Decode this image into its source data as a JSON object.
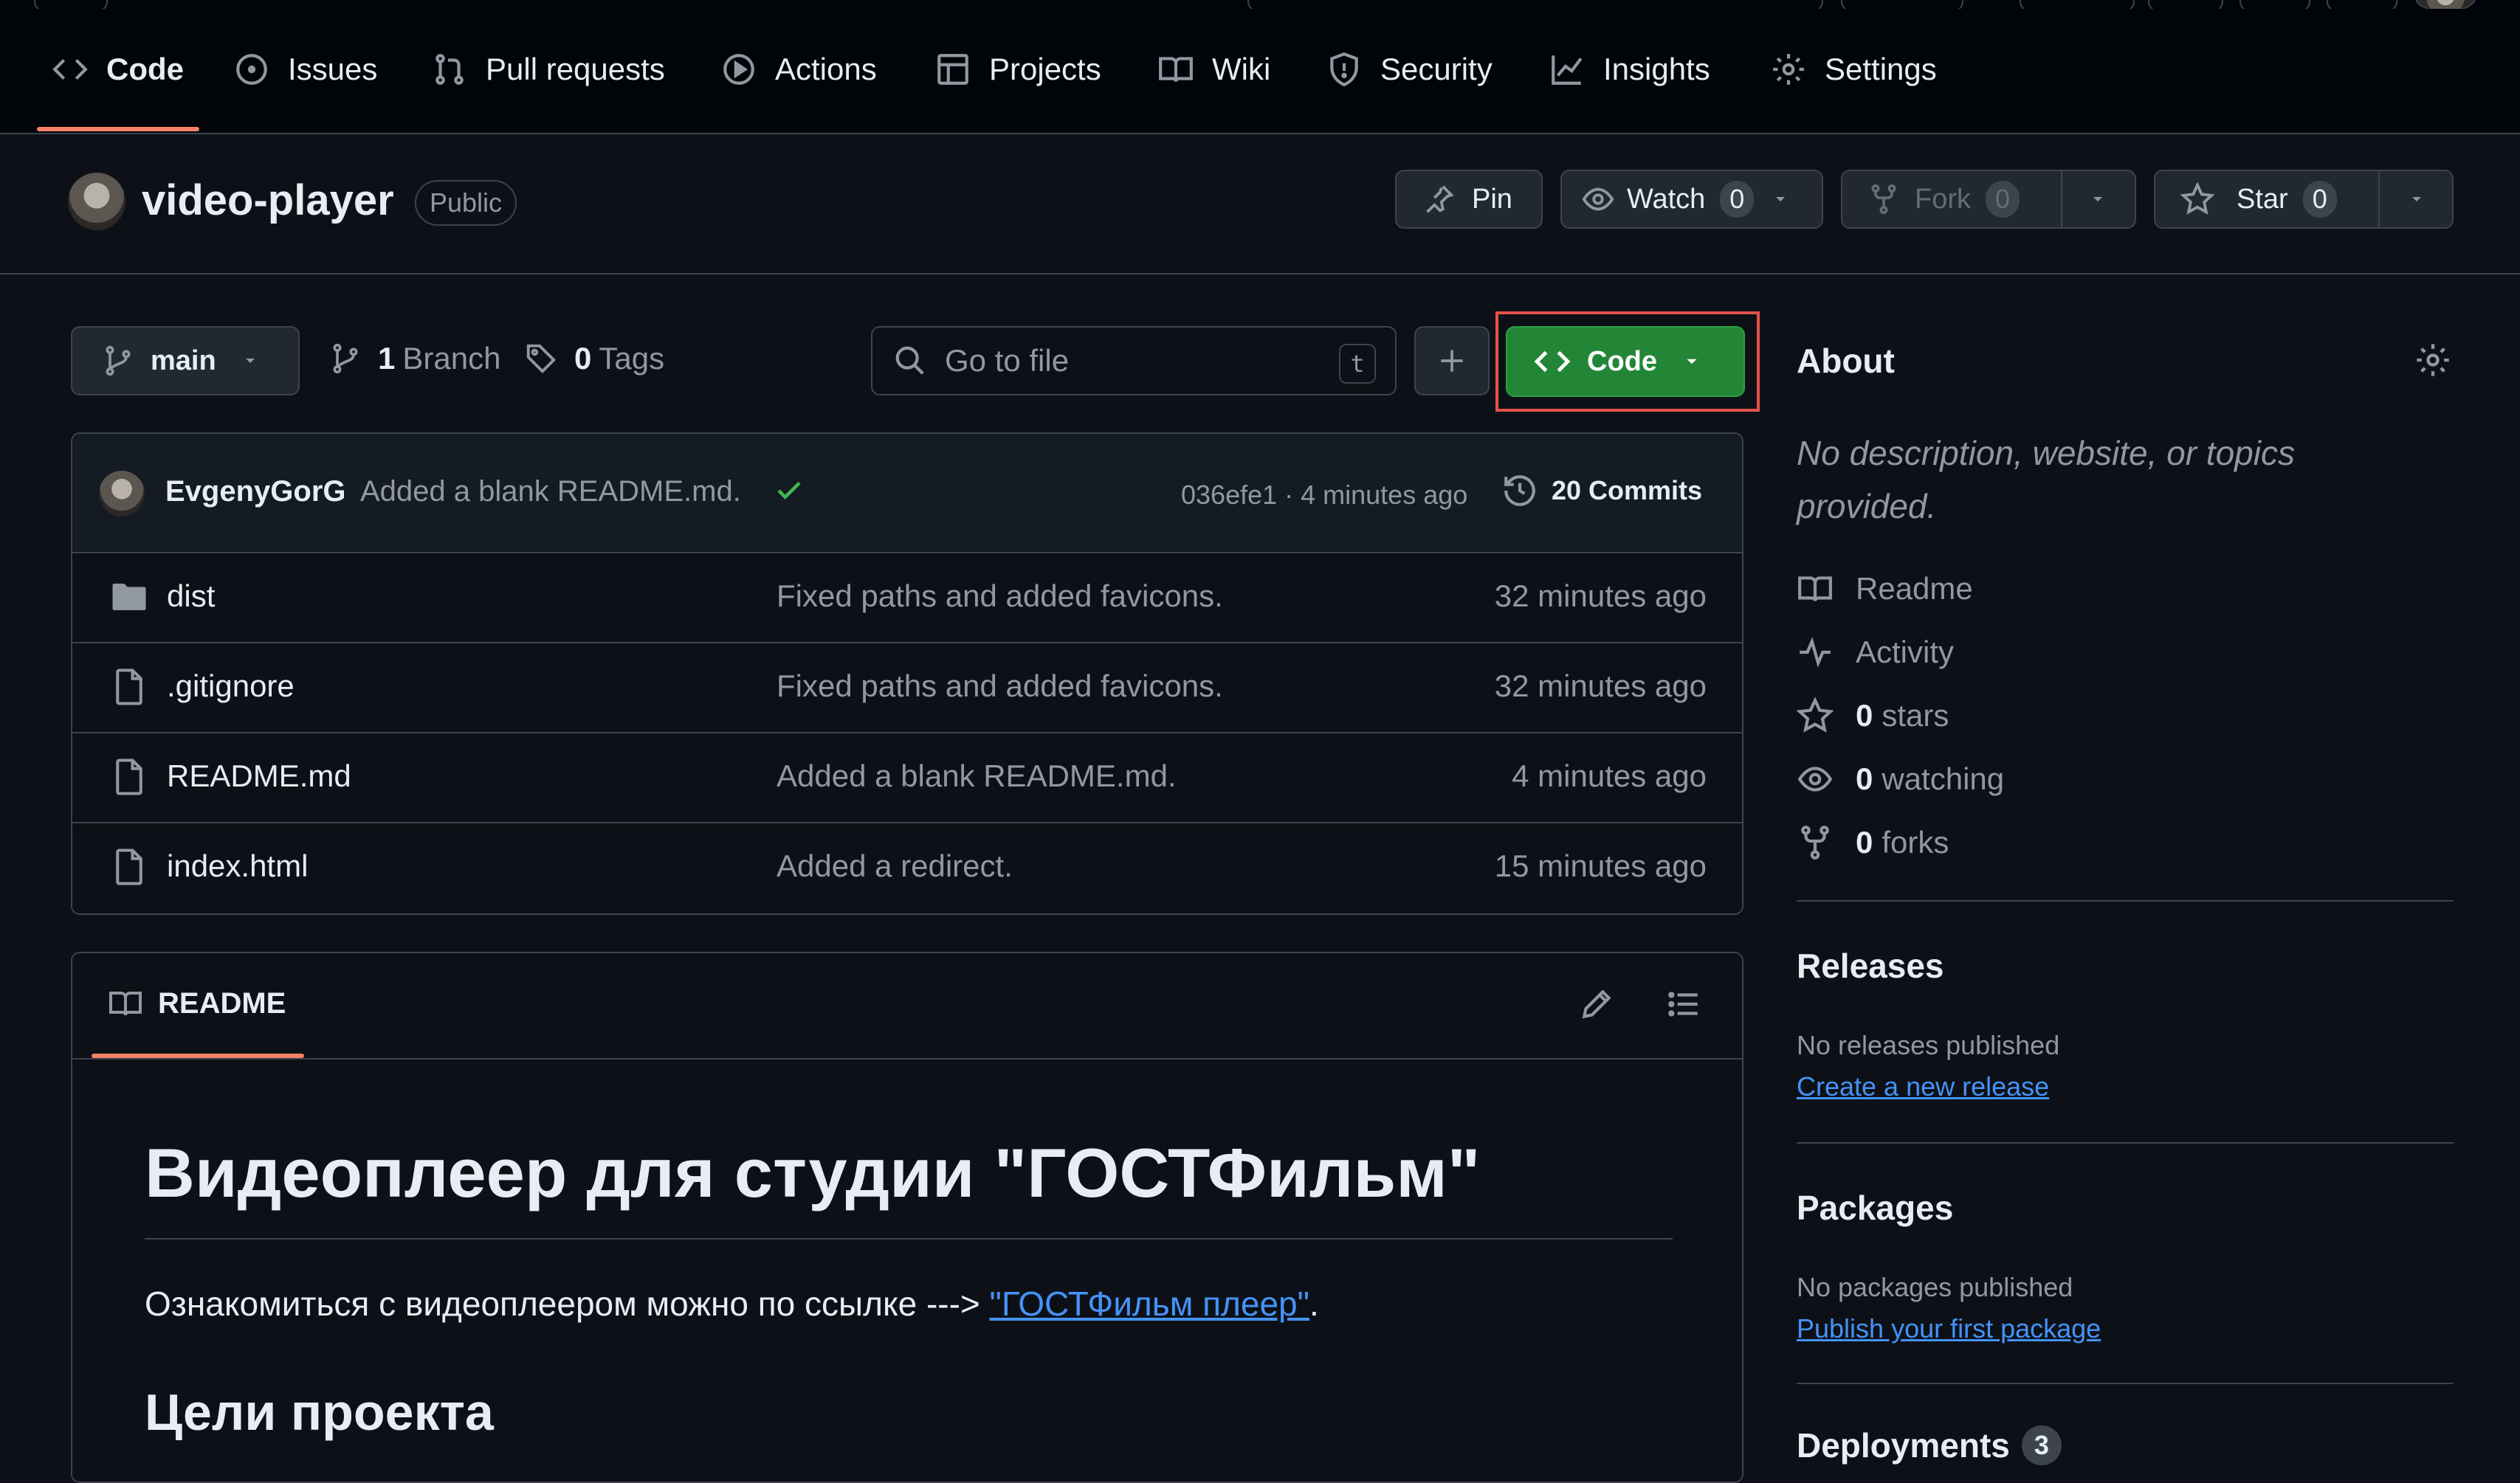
{
  "nav": {
    "items": [
      {
        "label": "Code",
        "icon": "code-icon",
        "active": true
      },
      {
        "label": "Issues",
        "icon": "issue-icon"
      },
      {
        "label": "Pull requests",
        "icon": "pull-request-icon"
      },
      {
        "label": "Actions",
        "icon": "play-icon"
      },
      {
        "label": "Projects",
        "icon": "table-icon"
      },
      {
        "label": "Wiki",
        "icon": "book-icon"
      },
      {
        "label": "Security",
        "icon": "shield-icon"
      },
      {
        "label": "Insights",
        "icon": "graph-icon"
      },
      {
        "label": "Settings",
        "icon": "gear-icon"
      }
    ]
  },
  "repo": {
    "name": "video-player",
    "visibility": "Public",
    "pin_label": "Pin",
    "watch_label": "Watch",
    "watch_count": "0",
    "fork_label": "Fork",
    "fork_count": "0",
    "star_label": "Star",
    "star_count": "0"
  },
  "toolbar": {
    "branch": "main",
    "branch_count": "1",
    "branch_label": "Branch",
    "tag_count": "0",
    "tag_label": "Tags",
    "search_placeholder": "Go to file",
    "search_shortcut": "t",
    "code_label": "Code"
  },
  "commit": {
    "author": "EvgenyGorG",
    "message": "Added a blank README.md.",
    "hash_time": "036efe1 · 4 minutes ago",
    "commits_count": "20",
    "commits_label": "Commits"
  },
  "files": [
    {
      "name": "dist",
      "type": "folder",
      "message": "Fixed paths and added favicons.",
      "time": "32 minutes ago"
    },
    {
      "name": ".gitignore",
      "type": "file",
      "message": "Fixed paths and added favicons.",
      "time": "32 minutes ago"
    },
    {
      "name": "README.md",
      "type": "file",
      "message": "Added a blank README.md.",
      "time": "4 minutes ago"
    },
    {
      "name": "index.html",
      "type": "file",
      "message": "Added a redirect.",
      "time": "15 minutes ago"
    }
  ],
  "readme": {
    "tab_label": "README",
    "title": "Видеоплеер для студии \"ГОСТФильм\"",
    "intro_text": "Ознакомиться с видеоплеером можно по ссылке --->",
    "intro_link": "\"ГОСТФильм плеер\"",
    "intro_end": ".",
    "section_title": "Цели проекта"
  },
  "about": {
    "title": "About",
    "description": "No description, website, or topics provided.",
    "readme_label": "Readme",
    "activity_label": "Activity",
    "stars_count": "0",
    "stars_label": "stars",
    "watching_count": "0",
    "watching_label": "watching",
    "forks_count": "0",
    "forks_label": "forks"
  },
  "releases": {
    "title": "Releases",
    "empty_text": "No releases published",
    "create_link": "Create a new release"
  },
  "packages": {
    "title": "Packages",
    "empty_text": "No packages published",
    "publish_link": "Publish your first package"
  },
  "deployments": {
    "title": "Deployments",
    "count": "3"
  },
  "colors": {
    "background": "#0d1117",
    "border": "#3d444d",
    "accent_green": "#238636",
    "link_blue": "#4493f8",
    "nav_underline": "#f78166",
    "highlight_red": "#e5534b"
  }
}
